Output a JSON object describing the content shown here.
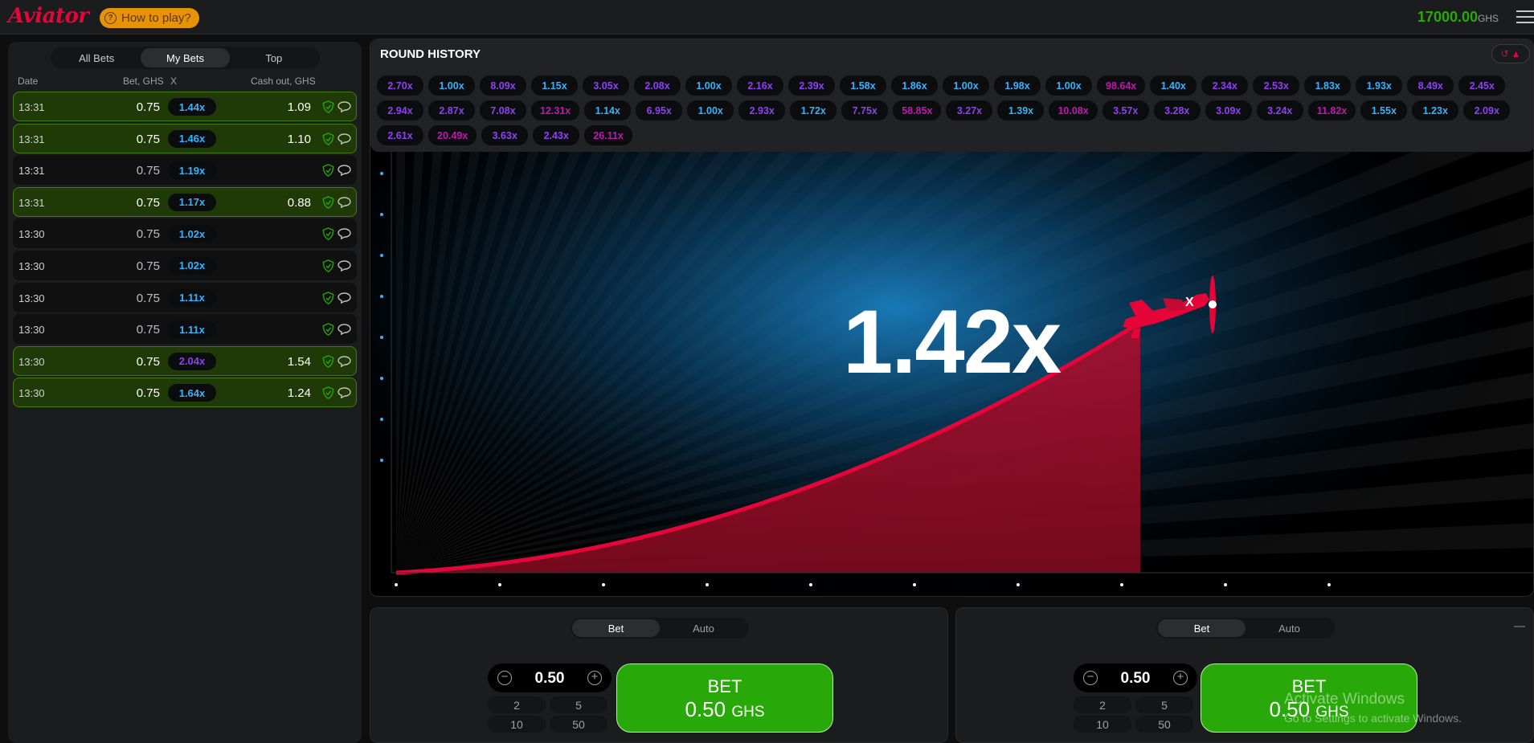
{
  "header": {
    "logo": "Aviator",
    "how_to_play": "How to play?",
    "balance": "17000.00",
    "currency": "GHS"
  },
  "bets_panel": {
    "tabs": [
      "All Bets",
      "My Bets",
      "Top"
    ],
    "active_tab": "My Bets",
    "columns": {
      "date": "Date",
      "bet": "Bet, GHS",
      "x": "X",
      "cashout": "Cash out, GHS"
    },
    "rows": [
      {
        "date": "13:31",
        "bet": "0.75",
        "mult": "1.44x",
        "cash": "1.09",
        "win": true,
        "color": "blue"
      },
      {
        "date": "13:31",
        "bet": "0.75",
        "mult": "1.46x",
        "cash": "1.10",
        "win": true,
        "color": "blue"
      },
      {
        "date": "13:31",
        "bet": "0.75",
        "mult": "1.19x",
        "cash": "",
        "win": false,
        "color": "blue"
      },
      {
        "date": "13:31",
        "bet": "0.75",
        "mult": "1.17x",
        "cash": "0.88",
        "win": true,
        "color": "blue"
      },
      {
        "date": "13:30",
        "bet": "0.75",
        "mult": "1.02x",
        "cash": "",
        "win": false,
        "color": "blue"
      },
      {
        "date": "13:30",
        "bet": "0.75",
        "mult": "1.02x",
        "cash": "",
        "win": false,
        "color": "blue"
      },
      {
        "date": "13:30",
        "bet": "0.75",
        "mult": "1.11x",
        "cash": "",
        "win": false,
        "color": "blue"
      },
      {
        "date": "13:30",
        "bet": "0.75",
        "mult": "1.11x",
        "cash": "",
        "win": false,
        "color": "blue"
      },
      {
        "date": "13:30",
        "bet": "0.75",
        "mult": "2.04x",
        "cash": "1.54",
        "win": true,
        "color": "purple"
      },
      {
        "date": "13:30",
        "bet": "0.75",
        "mult": "1.64x",
        "cash": "1.24",
        "win": true,
        "color": "blue"
      }
    ]
  },
  "round_history": {
    "title": "ROUND HISTORY",
    "values": [
      {
        "v": "2.70x",
        "c": "purple"
      },
      {
        "v": "1.00x",
        "c": "blue"
      },
      {
        "v": "8.09x",
        "c": "purple"
      },
      {
        "v": "1.15x",
        "c": "blue"
      },
      {
        "v": "3.05x",
        "c": "purple"
      },
      {
        "v": "2.08x",
        "c": "purple"
      },
      {
        "v": "1.00x",
        "c": "blue"
      },
      {
        "v": "2.16x",
        "c": "purple"
      },
      {
        "v": "2.39x",
        "c": "purple"
      },
      {
        "v": "1.58x",
        "c": "blue"
      },
      {
        "v": "1.86x",
        "c": "blue"
      },
      {
        "v": "1.00x",
        "c": "blue"
      },
      {
        "v": "1.98x",
        "c": "blue"
      },
      {
        "v": "1.00x",
        "c": "blue"
      },
      {
        "v": "98.64x",
        "c": "pink"
      },
      {
        "v": "1.40x",
        "c": "blue"
      },
      {
        "v": "2.34x",
        "c": "purple"
      },
      {
        "v": "2.53x",
        "c": "purple"
      },
      {
        "v": "1.83x",
        "c": "blue"
      },
      {
        "v": "1.93x",
        "c": "blue"
      },
      {
        "v": "8.49x",
        "c": "purple"
      },
      {
        "v": "2.45x",
        "c": "purple"
      },
      {
        "v": "2.94x",
        "c": "purple"
      },
      {
        "v": "2.87x",
        "c": "purple"
      },
      {
        "v": "7.08x",
        "c": "purple"
      },
      {
        "v": "12.31x",
        "c": "pink"
      },
      {
        "v": "1.14x",
        "c": "blue"
      },
      {
        "v": "6.95x",
        "c": "purple"
      },
      {
        "v": "1.00x",
        "c": "blue"
      },
      {
        "v": "2.93x",
        "c": "purple"
      },
      {
        "v": "1.72x",
        "c": "blue"
      },
      {
        "v": "7.75x",
        "c": "purple"
      },
      {
        "v": "58.85x",
        "c": "pink"
      },
      {
        "v": "3.27x",
        "c": "purple"
      },
      {
        "v": "1.39x",
        "c": "blue"
      },
      {
        "v": "10.08x",
        "c": "pink"
      },
      {
        "v": "3.57x",
        "c": "purple"
      },
      {
        "v": "3.28x",
        "c": "purple"
      },
      {
        "v": "3.09x",
        "c": "purple"
      },
      {
        "v": "3.24x",
        "c": "purple"
      },
      {
        "v": "11.82x",
        "c": "pink"
      },
      {
        "v": "1.55x",
        "c": "blue"
      },
      {
        "v": "1.23x",
        "c": "blue"
      },
      {
        "v": "2.09x",
        "c": "purple"
      },
      {
        "v": "2.61x",
        "c": "purple"
      },
      {
        "v": "20.49x",
        "c": "pink"
      },
      {
        "v": "3.63x",
        "c": "purple"
      },
      {
        "v": "2.43x",
        "c": "purple"
      },
      {
        "v": "26.11x",
        "c": "pink"
      }
    ]
  },
  "game": {
    "multiplier": "1.42x"
  },
  "bet_panels": [
    {
      "tabs": [
        "Bet",
        "Auto"
      ],
      "amount": "0.50",
      "quick": [
        "2",
        "5",
        "10",
        "50"
      ],
      "btn_label": "BET",
      "btn_amount": "0.50",
      "btn_currency": "GHS"
    },
    {
      "tabs": [
        "Bet",
        "Auto"
      ],
      "amount": "0.50",
      "quick": [
        "2",
        "5",
        "10",
        "50"
      ],
      "btn_label": "BET",
      "btn_amount": "0.50",
      "btn_currency": "GHS"
    }
  ],
  "overlay": {
    "activate_title": "Activate Windows",
    "activate_sub": "Go to Settings to activate Windows."
  },
  "colors": {
    "blue": "#34b4ff",
    "purple": "#913ef8",
    "pink": "#c017b4",
    "accent_red": "#e50539",
    "green": "#28a909"
  }
}
